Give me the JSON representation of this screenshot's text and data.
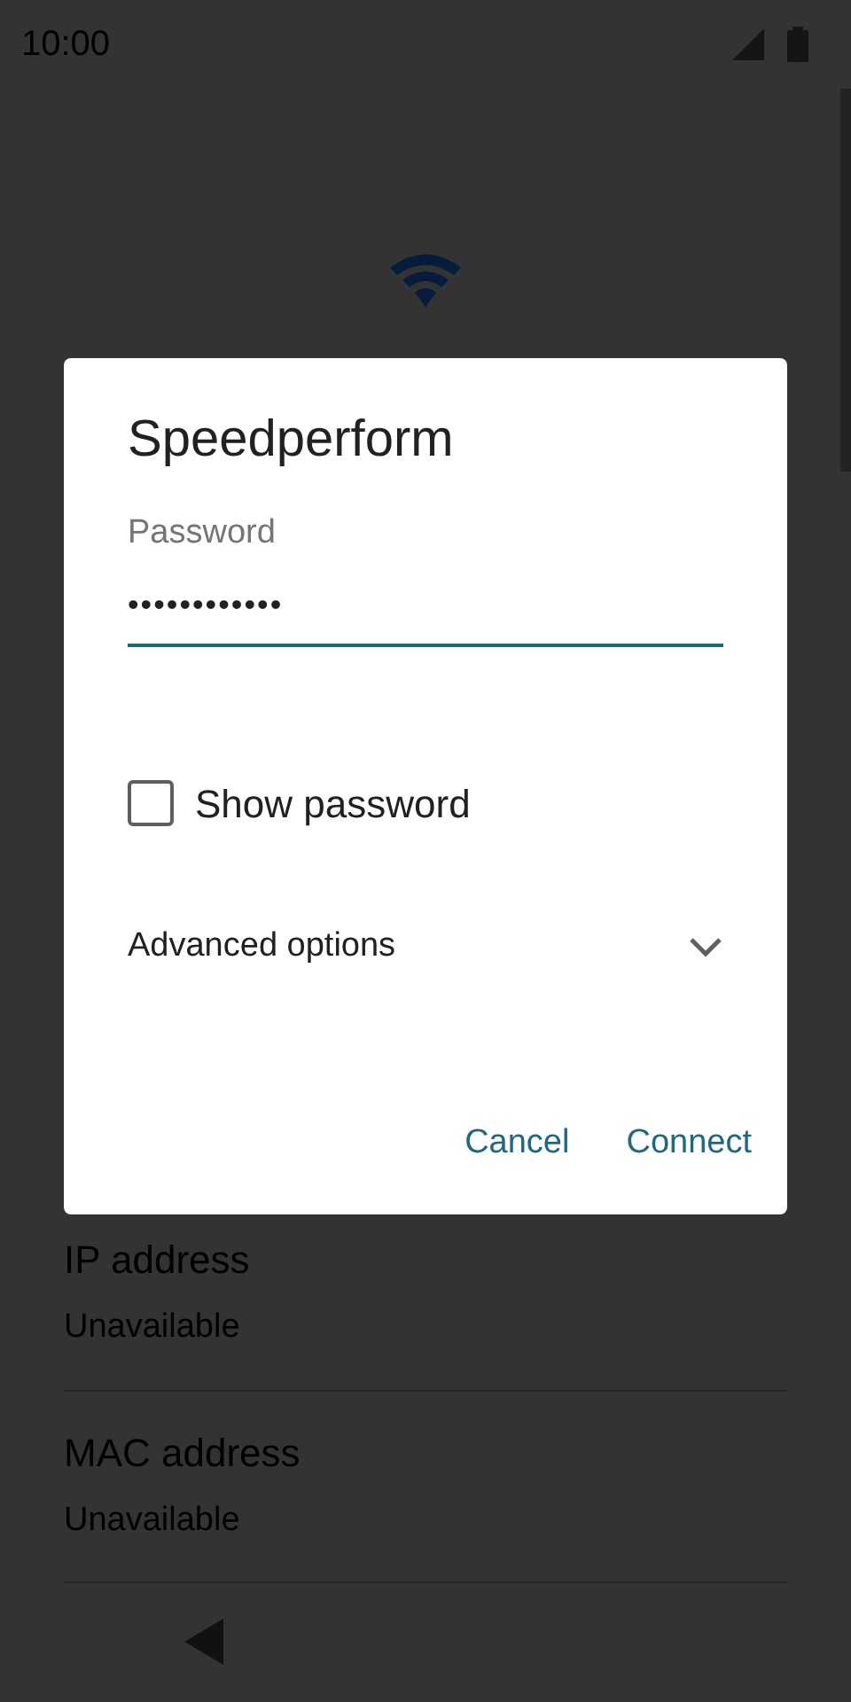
{
  "status_bar": {
    "time": "10:00"
  },
  "details": [
    {
      "label": "IP address",
      "value": "Unavailable"
    },
    {
      "label": "MAC address",
      "value": "Unavailable"
    }
  ],
  "dialog": {
    "title": "Speedperform",
    "password": {
      "label": "Password",
      "value": "••••••••••••"
    },
    "show_password": {
      "label": "Show password",
      "checked": false
    },
    "advanced": {
      "label": "Advanced options",
      "expanded": false
    },
    "buttons": [
      "Cancel",
      "Connect"
    ]
  }
}
